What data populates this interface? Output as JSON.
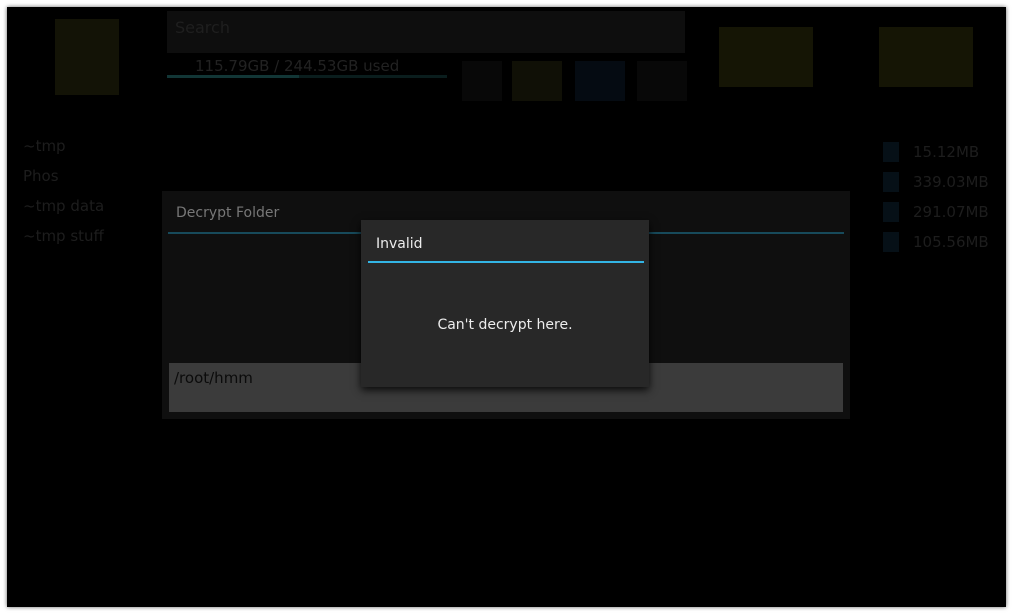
{
  "app": {
    "search": {
      "placeholder": "Search"
    },
    "storage": {
      "used_text": "115.79GB / 244.53GB used",
      "fraction": 0.47
    },
    "files": [
      "~tmp",
      "Phos",
      "~tmp data",
      "~tmp stuff"
    ],
    "sizes": [
      "15.12MB",
      "339.03MB",
      "291.07MB",
      "105.56MB"
    ]
  },
  "outer_dialog": {
    "title": "Decrypt Folder",
    "path": "/root/hmm"
  },
  "inner_dialog": {
    "title": "Invalid",
    "message": "Can't decrypt here."
  },
  "colors": {
    "accent": "#33b5e5",
    "dialog_bg": "#282828",
    "backdrop": "#000000"
  }
}
